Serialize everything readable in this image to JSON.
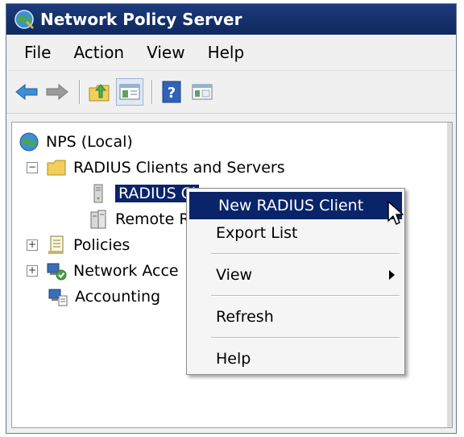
{
  "window": {
    "title": "Network Policy Server"
  },
  "menubar": {
    "items": [
      "File",
      "Action",
      "View",
      "Help"
    ]
  },
  "toolbar": {
    "icons": [
      "back-arrow-icon",
      "forward-arrow-icon",
      "up-folder-icon",
      "show-hide-tree-icon",
      "help-icon",
      "properties-icon"
    ]
  },
  "tree": {
    "root": "NPS (Local)",
    "radius_clients_servers": "RADIUS Clients and Servers",
    "radius_clients": "RADIUS Cl",
    "remote_radius": "Remote R",
    "policies": "Policies",
    "network_access": "Network Acce",
    "accounting": "Accounting"
  },
  "context_menu": {
    "new_radius_client": "New RADIUS Client",
    "export_list": "Export List",
    "view": "View",
    "refresh": "Refresh",
    "help": "Help"
  },
  "colors": {
    "titlebar": "#14306a",
    "selection": "#0a246a"
  }
}
